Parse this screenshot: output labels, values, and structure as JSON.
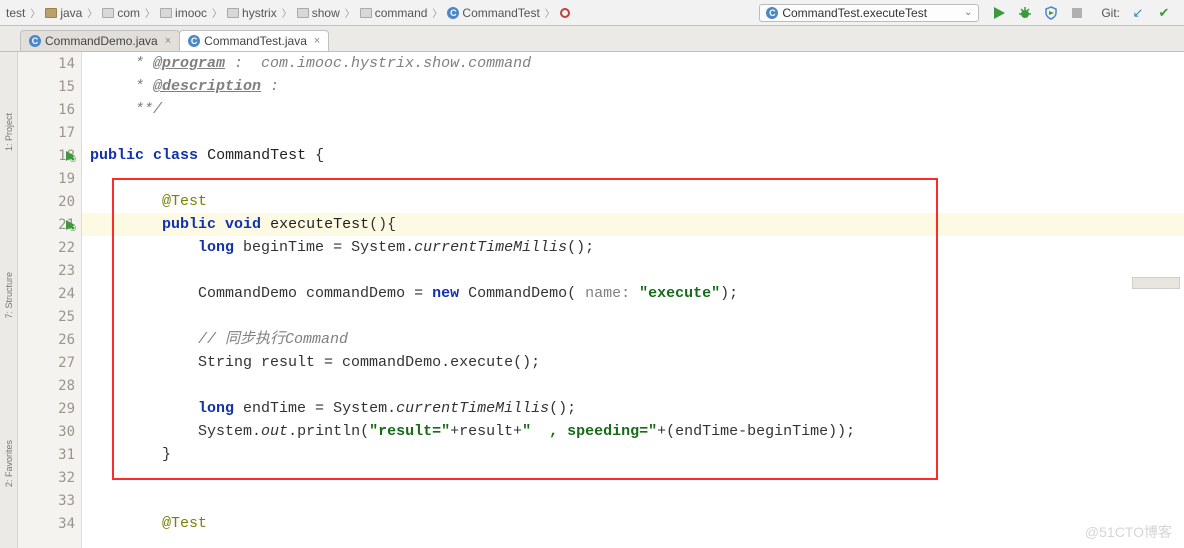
{
  "breadcrumbs": {
    "items": [
      {
        "label": "test"
      },
      {
        "label": "java"
      },
      {
        "label": "com"
      },
      {
        "label": "imooc"
      },
      {
        "label": "hystrix"
      },
      {
        "label": "show"
      },
      {
        "label": "command"
      },
      {
        "label": "CommandTest"
      },
      {
        "label": ""
      }
    ]
  },
  "run_config": {
    "label": "CommandTest.executeTest"
  },
  "git": {
    "label": "Git:"
  },
  "tabs": {
    "items": [
      {
        "label": "CommandDemo.java",
        "active": false
      },
      {
        "label": "CommandTest.java",
        "active": true
      }
    ]
  },
  "gutter": {
    "start": 14,
    "end": 34,
    "run_markers": [
      18,
      21
    ]
  },
  "sidebar": {
    "items": [
      {
        "label": "1: Project"
      },
      {
        "label": "7: Structure"
      },
      {
        "label": "2: Favorites"
      }
    ]
  },
  "code": {
    "l14": {
      "pre": "     * ",
      "tag": "@program",
      "post": " :  com.imooc.hystrix.show.command"
    },
    "l15": {
      "pre": "     * ",
      "tag": "@description",
      "post": " :"
    },
    "l16": "     **/",
    "l17": "",
    "l18": {
      "kw1": "public",
      "kw2": "class",
      "name": "CommandTest",
      "brace": " {"
    },
    "l19": "",
    "l20": {
      "indent": "        ",
      "ann": "@Test"
    },
    "l21": {
      "indent": "        ",
      "kw1": "public",
      "kw2": "void",
      "name": "executeTest",
      "tail": "(){"
    },
    "l22": {
      "indent": "            ",
      "kw": "long",
      "name": " beginTime = System.",
      "m": "currentTimeMillis",
      "tail": "();"
    },
    "l23": "",
    "l24": {
      "indent": "            ",
      "t1": "CommandDemo commandDemo = ",
      "kw": "new",
      "t2": " CommandDemo( ",
      "param": "name:",
      "sp": " ",
      "str": "\"execute\"",
      "tail": ");"
    },
    "l25": "",
    "l26": {
      "indent": "            ",
      "c": "// 同步执行Command"
    },
    "l27": {
      "indent": "            ",
      "t": "String result = commandDemo.execute();"
    },
    "l28": "",
    "l29": {
      "indent": "            ",
      "kw": "long",
      "t": " endTime = System.",
      "m": "currentTimeMillis",
      "tail": "();"
    },
    "l30": {
      "indent": "            ",
      "t1": "System.",
      "out": "out",
      "t2": ".println(",
      "s1": "\"result=\"",
      "t3": "+result+",
      "s2": "\"  , speeding=\"",
      "t4": "+(endTime-beginTime));"
    },
    "l31": "        }",
    "l32": "",
    "l33": "",
    "l34": {
      "indent": "        ",
      "ann": "@Test"
    }
  },
  "watermark": "@51CTO博客"
}
